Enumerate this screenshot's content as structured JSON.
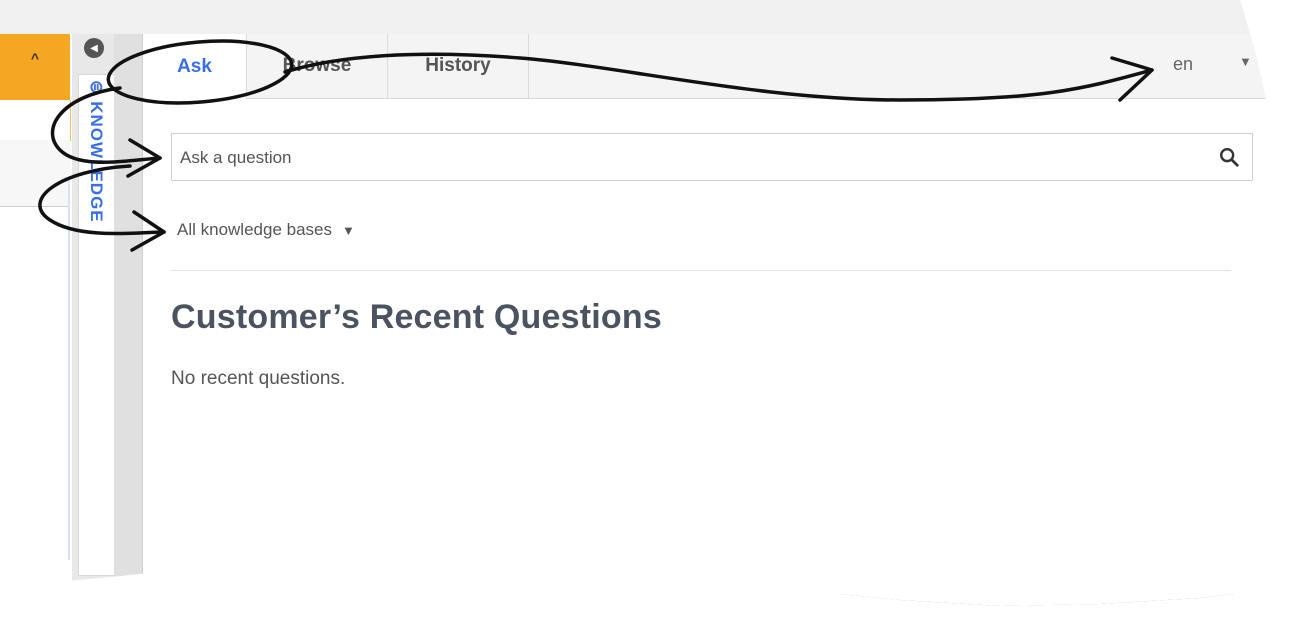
{
  "sidebar": {
    "vertical_tab_label": "KNOWLEDGE",
    "collapse_glyph": "^",
    "toggle_glyph": "◀"
  },
  "tabs": [
    {
      "label": "Ask",
      "active": true
    },
    {
      "label": "Browse",
      "active": false
    },
    {
      "label": "History",
      "active": false
    }
  ],
  "language": {
    "value": "en",
    "arrow": "▼"
  },
  "search": {
    "placeholder": "Ask a question",
    "icon": "search-icon"
  },
  "kb_selector": {
    "value": "All knowledge bases",
    "arrow": "▼"
  },
  "recent": {
    "heading": "Customer’s Recent Questions",
    "empty_text": "No recent questions."
  },
  "colors": {
    "accent": "#3a6ee8",
    "collapse_button": "#f5a623",
    "text": "#4b5360"
  }
}
